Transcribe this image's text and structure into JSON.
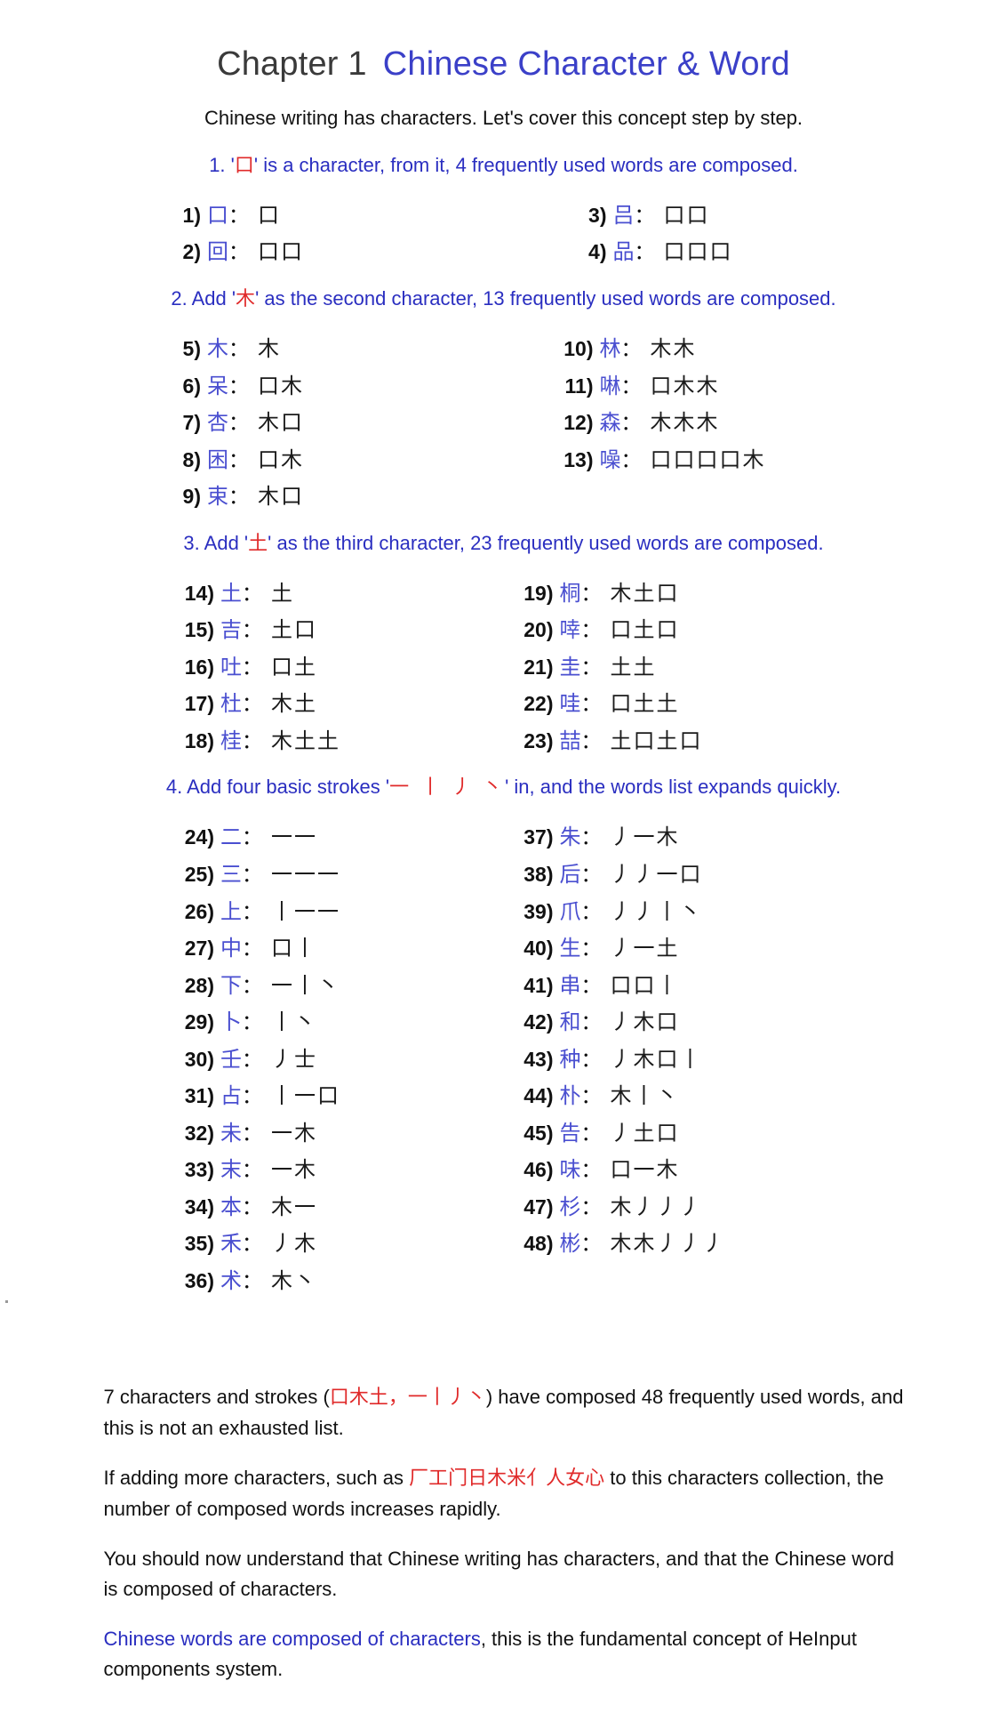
{
  "title": {
    "chapter": "Chapter 1",
    "name": "Chinese Character & Word"
  },
  "intro": "Chinese writing has characters. Let's cover this concept step by step.",
  "colors": {
    "heading_blue": "#2a2ec0",
    "highlight_red": "#e02a2a",
    "word_purple": "#4a4fd0",
    "title_gray": "#3a3a3a"
  },
  "sections": [
    {
      "heading_prefix": "1. '",
      "heading_highlight": "口",
      "heading_suffix": "' is a character, from it, 4 frequently used words are composed.",
      "left": [
        {
          "num": "1)",
          "word": "口",
          "colon": "：",
          "parts": "口"
        },
        {
          "num": "2)",
          "word": "回",
          "colon": "：",
          "parts": "口口"
        }
      ],
      "right": [
        {
          "num": "3)",
          "word": "吕",
          "colon": "：",
          "parts": "口口"
        },
        {
          "num": "4)",
          "word": "品",
          "colon": "：",
          "parts": "口口口"
        }
      ]
    },
    {
      "heading_prefix": "2. Add '",
      "heading_highlight": "木",
      "heading_suffix": "' as the second character, 13 frequently used words are composed.",
      "left": [
        {
          "num": "5)",
          "word": "木",
          "colon": "：",
          "parts": "木"
        },
        {
          "num": "6)",
          "word": "呆",
          "colon": "：",
          "parts": "口木"
        },
        {
          "num": "7)",
          "word": "杏",
          "colon": "：",
          "parts": "木口"
        },
        {
          "num": "8)",
          "word": "困",
          "colon": "：",
          "parts": "口木"
        },
        {
          "num": "9)",
          "word": "束",
          "colon": "：",
          "parts": "木口"
        }
      ],
      "right": [
        {
          "num": "10)",
          "word": "林",
          "colon": "：",
          "parts": "木木"
        },
        {
          "num": "11)",
          "word": "啉",
          "colon": "：",
          "parts": "口木木"
        },
        {
          "num": "12)",
          "word": "森",
          "colon": "：",
          "parts": "木木木"
        },
        {
          "num": "13)",
          "word": "噪",
          "colon": "：",
          "parts": "口口口口木"
        }
      ]
    },
    {
      "heading_prefix": "3. Add '",
      "heading_highlight": "土",
      "heading_suffix": "' as the third character, 23 frequently used words are composed.",
      "left": [
        {
          "num": "14)",
          "word": "土",
          "colon": "：",
          "parts": "土"
        },
        {
          "num": "15)",
          "word": "吉",
          "colon": "：",
          "parts": "土口"
        },
        {
          "num": "16)",
          "word": "吐",
          "colon": "：",
          "parts": "口土"
        },
        {
          "num": "17)",
          "word": "杜",
          "colon": "：",
          "parts": "木土"
        },
        {
          "num": "18)",
          "word": "桂",
          "colon": "：",
          "parts": "木土土"
        }
      ],
      "right": [
        {
          "num": "19)",
          "word": "桐",
          "colon": "：",
          "parts": "木土口"
        },
        {
          "num": "20)",
          "word": "啈",
          "colon": "：",
          "parts": "口土口"
        },
        {
          "num": "21)",
          "word": "圭",
          "colon": "：",
          "parts": "土土"
        },
        {
          "num": "22)",
          "word": "哇",
          "colon": "：",
          "parts": "口土土"
        },
        {
          "num": "23)",
          "word": "喆",
          "colon": "：",
          "parts": "土口土口"
        }
      ]
    },
    {
      "heading_prefix": "4. Add four basic strokes '",
      "heading_highlight": "一 丨 丿 丶",
      "heading_suffix": "' in, and the words list expands quickly.",
      "left": [
        {
          "num": "24)",
          "word": "二",
          "colon": "：",
          "parts": "一一"
        },
        {
          "num": "25)",
          "word": "三",
          "colon": "：",
          "parts": "一一一"
        },
        {
          "num": "26)",
          "word": "上",
          "colon": "：",
          "parts": "丨一一"
        },
        {
          "num": "27)",
          "word": "中",
          "colon": "：",
          "parts": "口丨"
        },
        {
          "num": "28)",
          "word": "下",
          "colon": "：",
          "parts": "一丨丶"
        },
        {
          "num": "29)",
          "word": "卜",
          "colon": "：",
          "parts": "丨丶"
        },
        {
          "num": "30)",
          "word": "壬",
          "colon": "：",
          "parts": "丿士"
        },
        {
          "num": "31)",
          "word": "占",
          "colon": "：",
          "parts": "丨一口"
        },
        {
          "num": "32)",
          "word": "未",
          "colon": "：",
          "parts": "一木"
        },
        {
          "num": "33)",
          "word": "末",
          "colon": "：",
          "parts": "一木"
        },
        {
          "num": "34)",
          "word": "本",
          "colon": "：",
          "parts": "木一"
        },
        {
          "num": "35)",
          "word": "禾",
          "colon": "：",
          "parts": "丿木"
        },
        {
          "num": "36)",
          "word": "术",
          "colon": "：",
          "parts": "木丶"
        }
      ],
      "right": [
        {
          "num": "37)",
          "word": "朱",
          "colon": "：",
          "parts": "丿一木"
        },
        {
          "num": "38)",
          "word": "后",
          "colon": "：",
          "parts": "丿丿一口"
        },
        {
          "num": "39)",
          "word": "爪",
          "colon": "：",
          "parts": "丿丿丨丶"
        },
        {
          "num": "40)",
          "word": "生",
          "colon": "：",
          "parts": "丿一土"
        },
        {
          "num": "41)",
          "word": "串",
          "colon": "：",
          "parts": "口口丨"
        },
        {
          "num": "42)",
          "word": "和",
          "colon": "：",
          "parts": "丿木口"
        },
        {
          "num": "43)",
          "word": "种",
          "colon": "：",
          "parts": "丿木口丨"
        },
        {
          "num": "44)",
          "word": "朴",
          "colon": "：",
          "parts": "木丨丶"
        },
        {
          "num": "45)",
          "word": "告",
          "colon": "：",
          "parts": "丿土口"
        },
        {
          "num": "46)",
          "word": "味",
          "colon": "：",
          "parts": "口一木"
        },
        {
          "num": "47)",
          "word": "杉",
          "colon": "：",
          "parts": "木丿丿丿"
        },
        {
          "num": "48)",
          "word": "彬",
          "colon": "：",
          "parts": "木木丿丿丿"
        }
      ]
    }
  ],
  "footer": {
    "p1_a": "7 characters and strokes (",
    "p1_red": "口木土，一丨丿丶",
    "p1_b": ") have composed 48 frequently used words, and this is not an exhausted list.",
    "p2_a": "If adding more characters, such as ",
    "p2_red": "厂工门日木米亻人女心",
    "p2_b": " to this characters collection, the number of composed words increases rapidly.",
    "p3": "You should now understand that Chinese writing has characters, and that the Chinese word is composed of characters.",
    "p4_blue": "Chinese words are composed of characters",
    "p4_rest": ", this is the fundamental concept of HeInput components system."
  }
}
